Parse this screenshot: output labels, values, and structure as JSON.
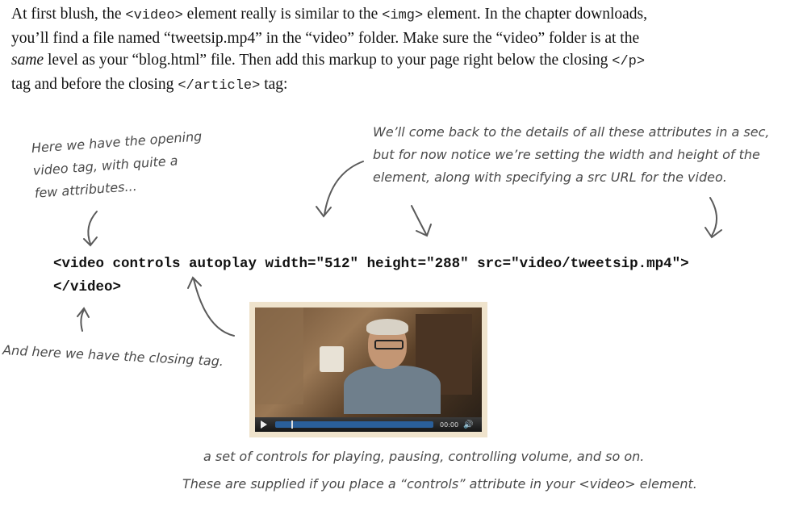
{
  "paragraph": {
    "p1": "At first blush, the ",
    "tag_video": "<video>",
    "p2": " element really is similar to the ",
    "tag_img": "<img>",
    "p3": " element. In the chapter downloads, you’ll find a file named “tweetsip.mp4” in the “video” folder. Make sure the “video” folder is at the ",
    "emphasis": "same",
    "p4": " level as your “blog.html” file. Then add this markup to your page right below the closing ",
    "tag_p_close": "</p>",
    "p5": " tag and before the closing ",
    "tag_article_close": "</article>",
    "p6": " tag:"
  },
  "annotations": {
    "opening_tag": [
      "Here we have the opening",
      "video tag, with quite a",
      "few attributes..."
    ],
    "attributes": [
      "We’ll come back to the details of all these attributes in a sec,",
      "but for now notice we’re setting the width and height of the",
      "element, along with specifying a src URL for the video."
    ],
    "closing_tag": [
      "And here we have the closing tag."
    ],
    "controls": [
      "a set of controls for playing, pausing, controlling volume, and so on.",
      "These are supplied if you place a “controls” attribute in your <video> element."
    ]
  },
  "code": {
    "line1": "<video controls autoplay width=\"512\" height=\"288\" src=\"video/tweetsip.mp4\">",
    "line2": "</video>"
  },
  "video_player": {
    "time": "00:00",
    "progress": 0.1,
    "play_icon": "play-icon",
    "volume_icon": "volume-icon"
  },
  "colors": {
    "annotation": "#4a4a4a",
    "progress": "#2a5f9a",
    "frame": "#efe3cc"
  }
}
